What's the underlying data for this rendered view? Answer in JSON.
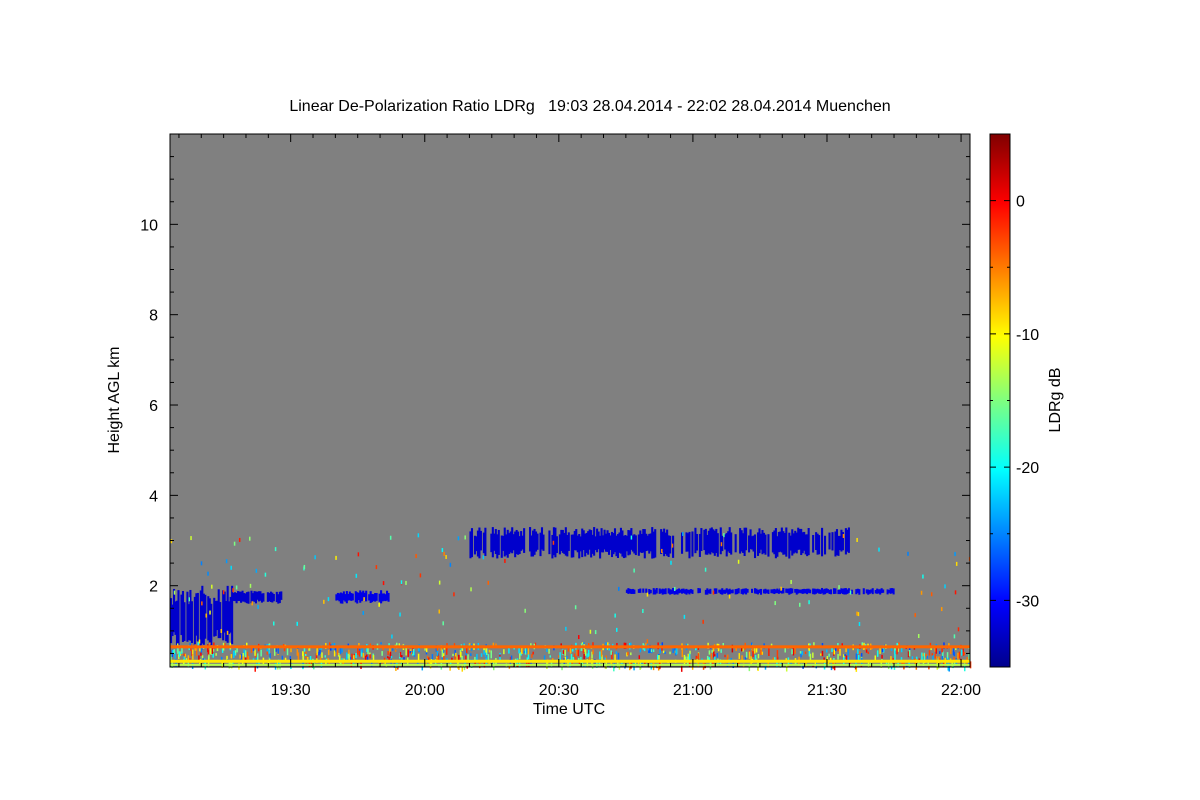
{
  "chart_data": {
    "type": "heatmap",
    "title": "Linear De-Polarization Ratio LDRg   19:03 28.04.2014 - 22:02 28.04.2014 Muenchen",
    "xlabel": "Time UTC",
    "ylabel": "Height AGL km",
    "x_ticks": [
      "19:30",
      "20:00",
      "20:30",
      "21:00",
      "21:30",
      "22:00"
    ],
    "y_ticks": [
      "2",
      "4",
      "6",
      "8",
      "10"
    ],
    "xlim": [
      "19:03",
      "22:02"
    ],
    "ylim": [
      0.2,
      12
    ],
    "background_color": "#808080",
    "colorbar": {
      "label": "LDRg dB",
      "range": [
        -35,
        5
      ],
      "ticks": [
        "0",
        "-10",
        "-20",
        "-30"
      ],
      "colormap": "jet"
    },
    "features": [
      {
        "start": "19:03",
        "end": "19:17",
        "base_km": 0.6,
        "top_km": 2.0,
        "ldr_db": -32
      },
      {
        "start": "19:17",
        "end": "19:28",
        "base_km": 1.6,
        "top_km": 1.9,
        "ldr_db": -32
      },
      {
        "start": "19:40",
        "end": "19:52",
        "base_km": 1.6,
        "top_km": 1.9,
        "ldr_db": -31
      },
      {
        "start": "20:10",
        "end": "21:35",
        "base_km": 2.6,
        "top_km": 3.3,
        "ldr_db": -32
      },
      {
        "start": "20:45",
        "end": "21:45",
        "base_km": 1.8,
        "top_km": 1.95,
        "ldr_db": -31
      },
      {
        "start": "19:03",
        "end": "22:02",
        "base_km": 0.25,
        "top_km": 0.75,
        "ldr_db": -12
      }
    ]
  }
}
